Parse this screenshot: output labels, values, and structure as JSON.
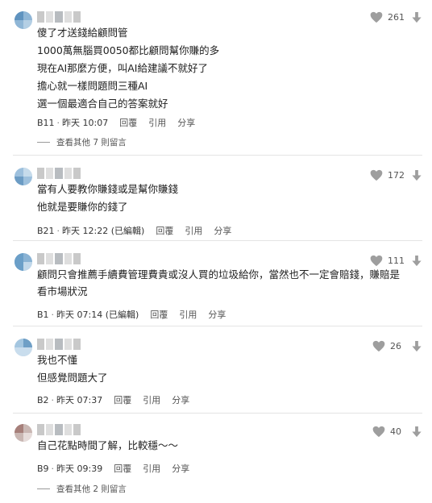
{
  "colors": {
    "icon_gray": "#9e9e9e",
    "divider": "#e4e4e4",
    "text": "#222222"
  },
  "icons": {
    "like": "heart-icon",
    "dislike": "down-arrow-icon"
  },
  "actions": {
    "reply": "回覆",
    "quote": "引用",
    "share": "分享"
  },
  "comments": [
    {
      "lines": [
        "傻了才送錢給顧問管",
        "1000萬無腦買0050都比顧問幫你賺的多",
        "現在AI那麼方便，叫AI給建議不就好了",
        "擔心就一樣問題問三種AI",
        "選一個最適合自己的答案就好"
      ],
      "floor": "B11",
      "time": "昨天 10:07",
      "edited": "",
      "likes": "261",
      "more_replies": "查看其他 7 則留言"
    },
    {
      "lines": [
        "當有人要教你賺錢或是幫你賺錢",
        "他就是要賺你的錢了"
      ],
      "floor": "B21",
      "time": "昨天 12:22 (已編輯)",
      "likes": "172"
    },
    {
      "lines": [
        "顧問只會推薦手續費管理費貴或沒人買的垃圾給你，當然也不一定會賠錢，賺賠是看市場狀況"
      ],
      "floor": "B1",
      "time": "昨天 07:14 (已編輯)",
      "likes": "111"
    },
    {
      "lines": [
        "我也不懂",
        "但感覺問題大了"
      ],
      "floor": "B2",
      "time": "昨天 07:37",
      "likes": "26"
    },
    {
      "lines": [
        "自己花點時間了解，比較穩～～"
      ],
      "floor": "B9",
      "time": "昨天 09:39",
      "likes": "40",
      "more_replies": "查看其他 2 則留言"
    }
  ]
}
